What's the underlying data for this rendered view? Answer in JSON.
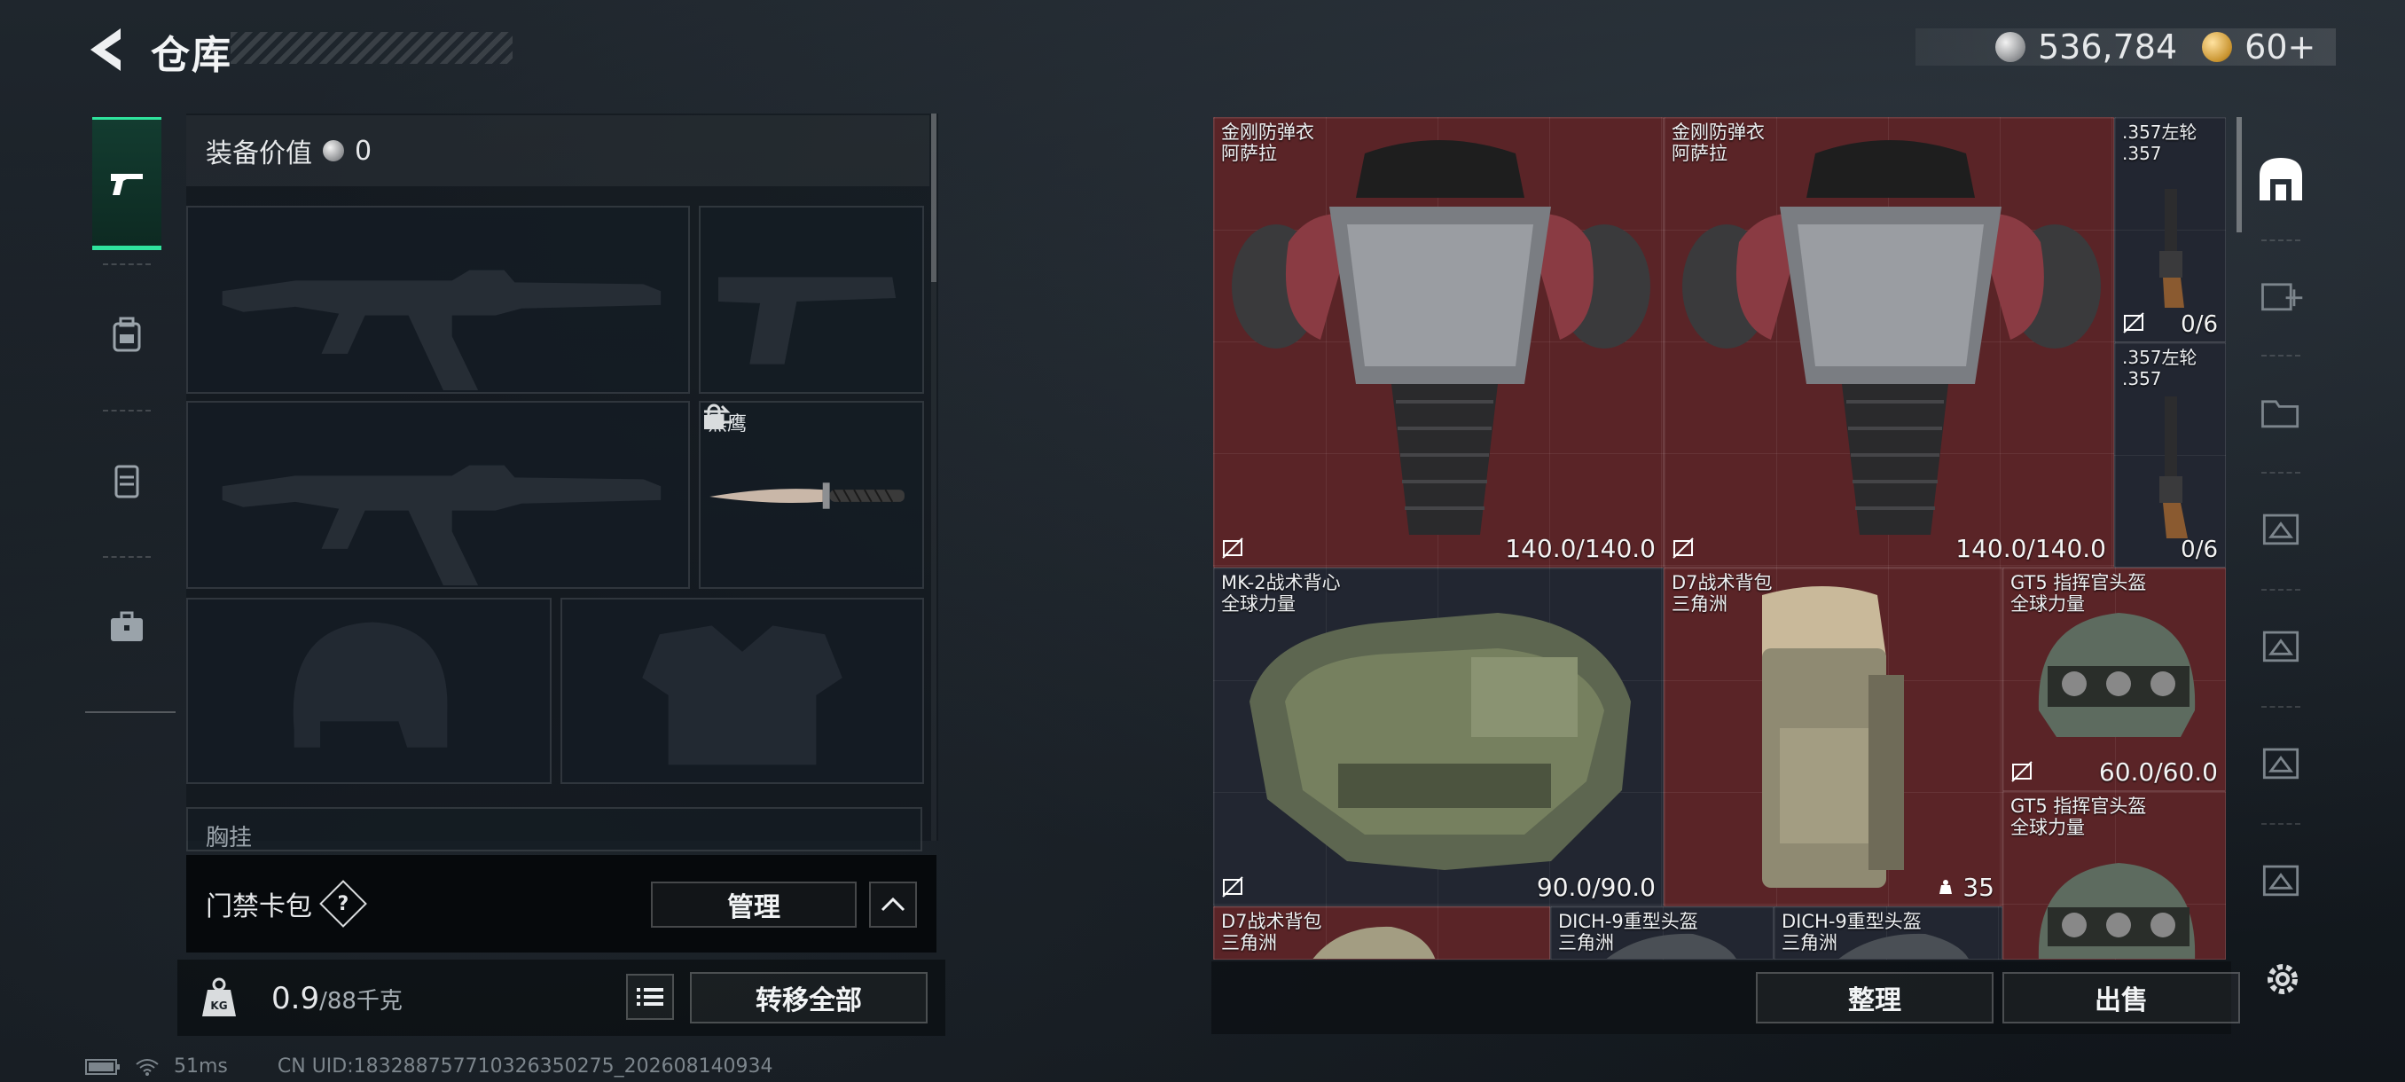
{
  "header": {
    "title": "仓库",
    "currency": {
      "silver": "536,784",
      "gold": "60+"
    }
  },
  "left": {
    "equip_value_label": "装备价值",
    "equip_value": "0",
    "knife_slot_label": "黑鹰",
    "chest_rig_label": "胸挂",
    "keycard_label": "门禁卡包",
    "keycard_help": "?",
    "manage_button": "管理",
    "weight_current": "0.9",
    "weight_max": "/88千克",
    "transfer_all_button": "转移全部"
  },
  "inventory": {
    "items": [
      {
        "name": "金刚防弹衣",
        "sub": "阿萨拉",
        "durability": "140.0/140.0"
      },
      {
        "name": "金刚防弹衣",
        "sub": "阿萨拉",
        "durability": "140.0/140.0"
      },
      {
        "name": ".357左轮",
        "sub": ".357",
        "ammo": "0/6"
      },
      {
        "name": ".357左轮",
        "sub": ".357",
        "ammo": "0/6"
      },
      {
        "name": "MK-2战术背心",
        "sub": "全球力量",
        "durability": "90.0/90.0"
      },
      {
        "name": "D7战术背包",
        "sub": "三角洲",
        "capacity": "35"
      },
      {
        "name": "GT5 指挥官头盔",
        "sub": "全球力量",
        "durability": "60.0/60.0"
      },
      {
        "name": "GT5 指挥官头盔",
        "sub": "全球力量"
      },
      {
        "name": "D7战术背包",
        "sub": "三角洲"
      },
      {
        "name": "DICH-9重型头盔",
        "sub": "三角洲"
      },
      {
        "name": "DICH-9重型头盔",
        "sub": "三角洲"
      }
    ],
    "sort_button": "整理",
    "sell_button": "出售"
  },
  "status": {
    "ping": "51ms",
    "uid": "CN UID:1832887577103263502​75_202608140934"
  },
  "colors": {
    "accent": "#2fe39d",
    "item_red": "#5a2427",
    "item_dark": "#222631"
  },
  "icons": [
    "back-arrow-icon",
    "pistol-icon",
    "backpack-icon",
    "vest-icon",
    "briefcase-icon",
    "lock-icon",
    "swap-icon",
    "list-icon",
    "chevron-up-icon",
    "weight-icon",
    "settings-icon",
    "wifi-icon",
    "battery-icon"
  ]
}
